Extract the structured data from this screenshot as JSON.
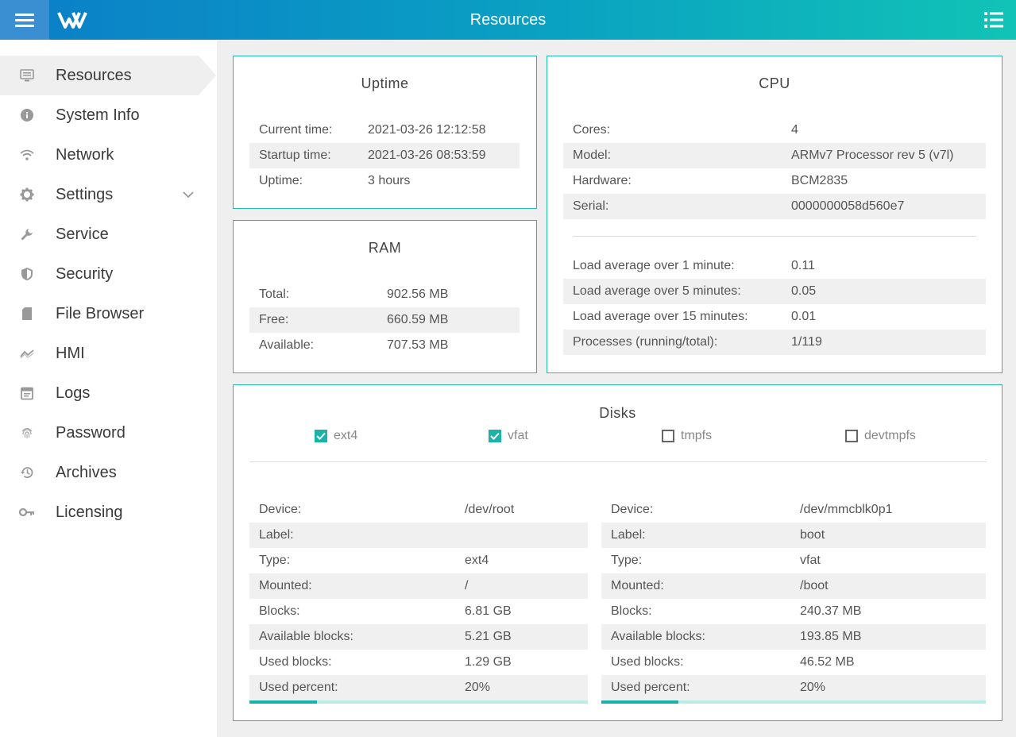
{
  "header": {
    "title": "Resources"
  },
  "sidebar": {
    "items": [
      {
        "label": "Resources",
        "icon": "monitor-icon"
      },
      {
        "label": "System Info",
        "icon": "info-icon"
      },
      {
        "label": "Network",
        "icon": "wifi-icon"
      },
      {
        "label": "Settings",
        "icon": "gear-icon"
      },
      {
        "label": "Service",
        "icon": "wrench-icon"
      },
      {
        "label": "Security",
        "icon": "shield-icon"
      },
      {
        "label": "File Browser",
        "icon": "sd-card-icon"
      },
      {
        "label": "HMI",
        "icon": "trend-icon"
      },
      {
        "label": "Logs",
        "icon": "calendar-icon"
      },
      {
        "label": "Password",
        "icon": "fingerprint-icon"
      },
      {
        "label": "Archives",
        "icon": "history-icon"
      },
      {
        "label": "Licensing",
        "icon": "key-icon"
      }
    ]
  },
  "uptime": {
    "title": "Uptime",
    "rows": [
      {
        "k": "Current time:",
        "v": "2021-03-26 12:12:58"
      },
      {
        "k": "Startup time:",
        "v": "2021-03-26 08:53:59"
      },
      {
        "k": "Uptime:",
        "v": "3 hours"
      }
    ]
  },
  "ram": {
    "title": "RAM",
    "rows": [
      {
        "k": "Total:",
        "v": "902.56 MB"
      },
      {
        "k": "Free:",
        "v": "660.59 MB"
      },
      {
        "k": "Available:",
        "v": "707.53 MB"
      }
    ]
  },
  "cpu": {
    "title": "CPU",
    "rows": [
      {
        "k": "Cores:",
        "v": "4"
      },
      {
        "k": "Model:",
        "v": "ARMv7 Processor rev 5 (v7l)"
      },
      {
        "k": "Hardware:",
        "v": "BCM2835"
      },
      {
        "k": "Serial:",
        "v": "0000000058d560e7"
      }
    ],
    "load_rows": [
      {
        "k": "Load average over 1 minute:",
        "v": "0.11"
      },
      {
        "k": "Load average over 5 minutes:",
        "v": "0.05"
      },
      {
        "k": "Load average over 15 minutes:",
        "v": "0.01"
      },
      {
        "k": "Processes (running/total):",
        "v": "1/119"
      }
    ]
  },
  "disks": {
    "title": "Disks",
    "filters": [
      {
        "label": "ext4",
        "checked": true
      },
      {
        "label": "vfat",
        "checked": true
      },
      {
        "label": "tmpfs",
        "checked": false
      },
      {
        "label": "devtmpfs",
        "checked": false
      }
    ],
    "items": [
      {
        "rows": [
          {
            "k": "Device:",
            "v": "/dev/root"
          },
          {
            "k": "Label:",
            "v": ""
          },
          {
            "k": "Type:",
            "v": "ext4"
          },
          {
            "k": "Mounted:",
            "v": "/"
          },
          {
            "k": "Blocks:",
            "v": "6.81 GB"
          },
          {
            "k": "Available blocks:",
            "v": "5.21 GB"
          },
          {
            "k": "Used blocks:",
            "v": "1.29 GB"
          },
          {
            "k": "Used percent:",
            "v": "20%"
          }
        ],
        "used_fraction": 0.2
      },
      {
        "rows": [
          {
            "k": "Device:",
            "v": "/dev/mmcblk0p1"
          },
          {
            "k": "Label:",
            "v": "boot"
          },
          {
            "k": "Type:",
            "v": "vfat"
          },
          {
            "k": "Mounted:",
            "v": "/boot"
          },
          {
            "k": "Blocks:",
            "v": "240.37 MB"
          },
          {
            "k": "Available blocks:",
            "v": "193.85 MB"
          },
          {
            "k": "Used blocks:",
            "v": "46.52 MB"
          },
          {
            "k": "Used percent:",
            "v": "20%"
          }
        ],
        "used_fraction": 0.2
      }
    ]
  },
  "colors": {
    "accent": "#18b3a6",
    "header_start": "#0b7ec8",
    "header_end": "#11c3b6"
  }
}
